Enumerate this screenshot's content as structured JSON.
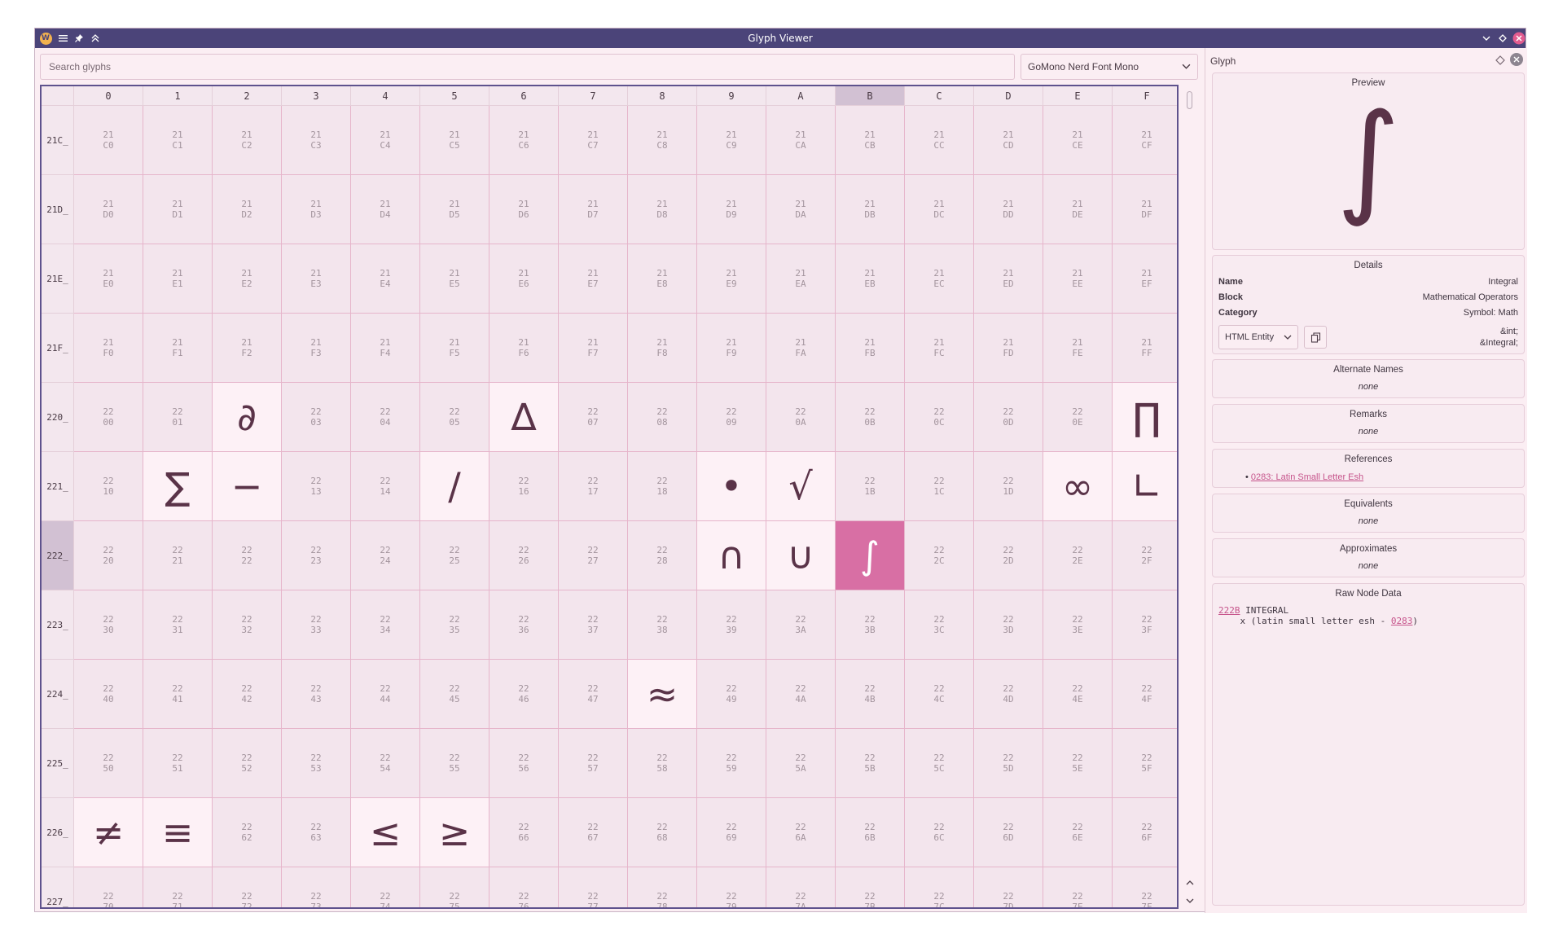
{
  "window": {
    "title": "Glyph Viewer"
  },
  "search": {
    "placeholder": "Search glyphs"
  },
  "font_select": {
    "value": "GoMono Nerd Font Mono"
  },
  "grid": {
    "columns": [
      "0",
      "1",
      "2",
      "3",
      "4",
      "5",
      "6",
      "7",
      "8",
      "9",
      "A",
      "B",
      "C",
      "D",
      "E",
      "F"
    ],
    "selected_column": "B",
    "selected_row": "222_",
    "rows": [
      {
        "label": "21C_",
        "prefix": "21",
        "suffix": "C"
      },
      {
        "label": "21D_",
        "prefix": "21",
        "suffix": "D"
      },
      {
        "label": "21E_",
        "prefix": "21",
        "suffix": "E"
      },
      {
        "label": "21F_",
        "prefix": "21",
        "suffix": "F"
      },
      {
        "label": "220_",
        "prefix": "22",
        "suffix": "0"
      },
      {
        "label": "221_",
        "prefix": "22",
        "suffix": "1"
      },
      {
        "label": "222_",
        "prefix": "22",
        "suffix": "2"
      },
      {
        "label": "223_",
        "prefix": "22",
        "suffix": "3"
      },
      {
        "label": "224_",
        "prefix": "22",
        "suffix": "4"
      },
      {
        "label": "225_",
        "prefix": "22",
        "suffix": "5"
      },
      {
        "label": "226_",
        "prefix": "22",
        "suffix": "6"
      },
      {
        "label": "227_",
        "prefix": "22",
        "suffix": "7"
      }
    ],
    "glyphs": {
      "2202": "∂",
      "2206": "∆",
      "220F": "∏",
      "2211": "∑",
      "2212": "−",
      "2215": "∕",
      "2219": "•",
      "221A": "√",
      "221E": "∞",
      "221F": "∟",
      "2229": "∩",
      "222A": "∪",
      "222B": "∫",
      "2248": "≈",
      "2260": "≠",
      "2261": "≡",
      "2264": "≤",
      "2265": "≥"
    },
    "selected_code": "222B"
  },
  "panel": {
    "title": "Glyph",
    "preview": {
      "title": "Preview",
      "glyph": "∫"
    },
    "details": {
      "title": "Details",
      "name_label": "Name",
      "name": "Integral",
      "block_label": "Block",
      "block": "Mathematical Operators",
      "category_label": "Category",
      "category": "Symbol: Math",
      "entity_select": "HTML Entity",
      "entity_values": [
        "&int;",
        "&Integral;"
      ]
    },
    "alternate_names": {
      "title": "Alternate Names",
      "value": "none"
    },
    "remarks": {
      "title": "Remarks",
      "value": "none"
    },
    "references": {
      "title": "References",
      "bullet": "•",
      "link": "0283: Latin Small Letter Esh"
    },
    "equivalents": {
      "title": "Equivalents",
      "value": "none"
    },
    "approximates": {
      "title": "Approximates",
      "value": "none"
    },
    "raw": {
      "title": "Raw Node Data",
      "code": "222B",
      "name": " INTEGRAL",
      "line2_prefix": "    x (latin small letter esh - ",
      "line2_link": "0283",
      "line2_suffix": ")"
    }
  },
  "colors": {
    "accent": "#d86fa4",
    "titlebar": "#4b4479",
    "grid_border": "#5e528d",
    "selection_header": "#d2c1d3"
  }
}
